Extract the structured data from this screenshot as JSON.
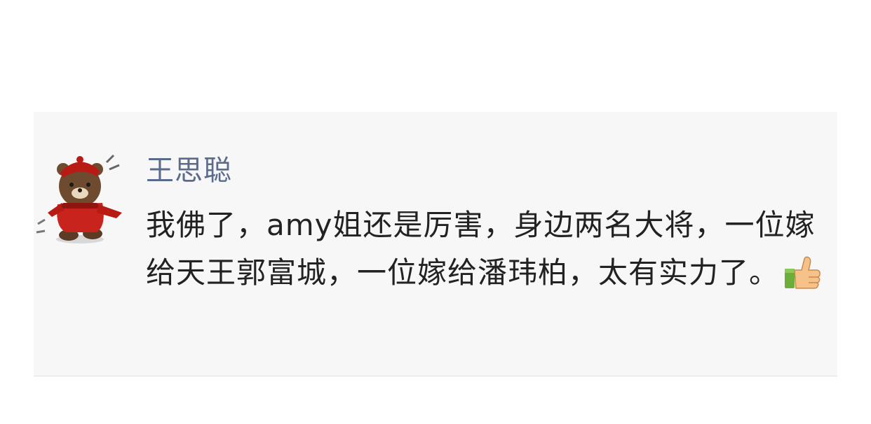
{
  "comment": {
    "author": "王思聪",
    "text": "我佛了，amy姐还是厉害，身边两名大将，一位嫁给天王郭富城，一位嫁给潘玮柏，太有实力了。",
    "avatar_icon": "brown-bear-red-scarf-sticker",
    "emoji_icon": "thumbs-up-icon"
  },
  "colors": {
    "author": "#5b6b8c",
    "text": "#222222",
    "card_background": "#f7f7f7"
  }
}
